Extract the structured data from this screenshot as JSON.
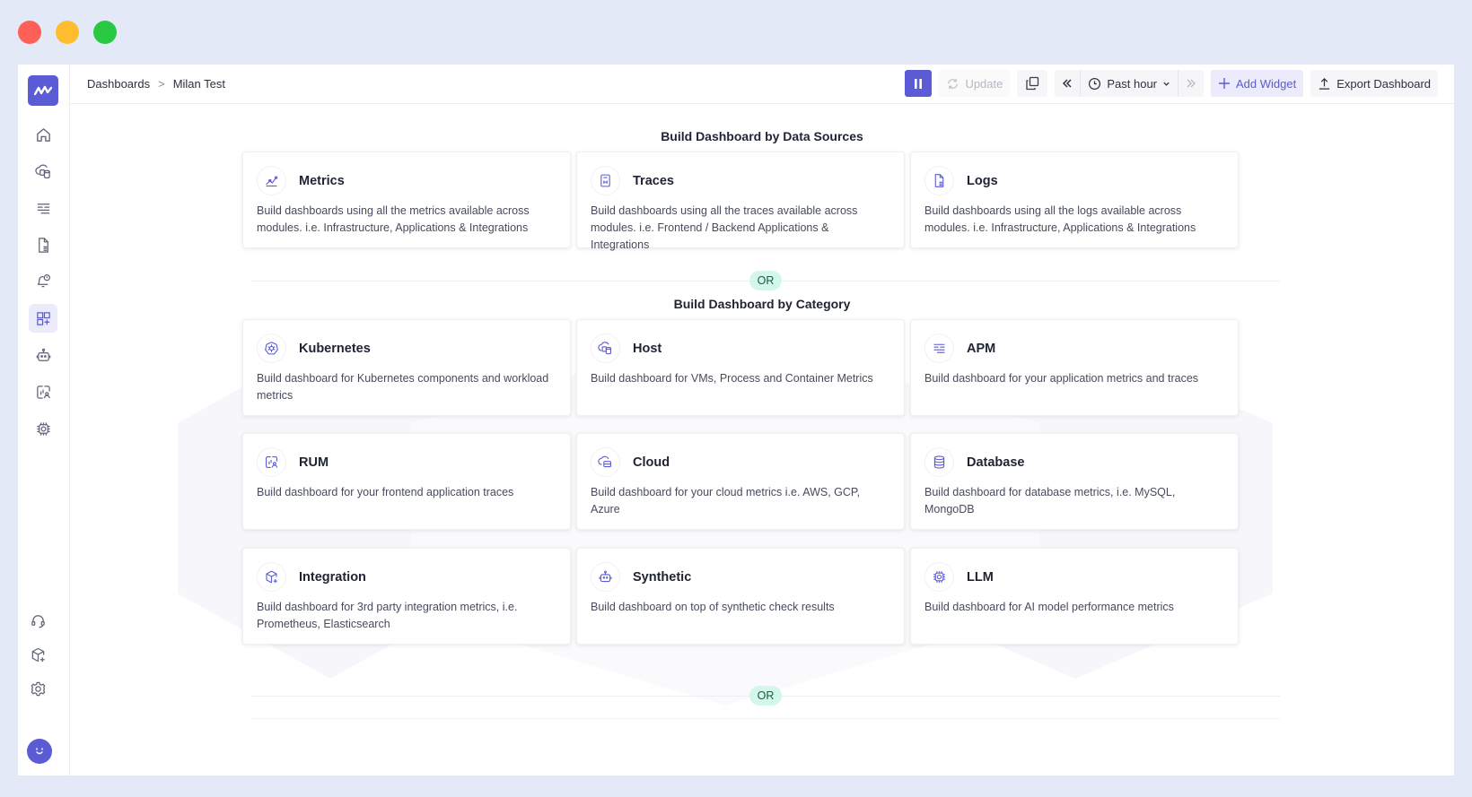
{
  "window": {
    "controls": [
      {
        "name": "close",
        "color": "#fe5f57"
      },
      {
        "name": "minimize",
        "color": "#febc2e"
      },
      {
        "name": "maximize",
        "color": "#28c840"
      }
    ]
  },
  "brand": {
    "accent": "#5b5bd6",
    "or_badge_bg": "#d3f7e8"
  },
  "breadcrumb": {
    "parent": "Dashboards",
    "separator": ">",
    "current": "Milan Test"
  },
  "toolbar": {
    "pause_icon": "pause-icon",
    "update_label": "Update",
    "copy_icon": "copy-icon",
    "prev_icon": "chevrons-left-icon",
    "time_range": "Past hour",
    "next_icon": "chevrons-right-icon",
    "add_widget_label": "Add Widget",
    "export_label": "Export Dashboard"
  },
  "sidebar": {
    "items": [
      {
        "name": "home",
        "icon": "home-icon"
      },
      {
        "name": "infrastructure",
        "icon": "cloud-database-icon"
      },
      {
        "name": "apm",
        "icon": "list-lines-icon"
      },
      {
        "name": "logs",
        "icon": "document-icon"
      },
      {
        "name": "alerts",
        "icon": "bell-alert-icon"
      },
      {
        "name": "dashboards",
        "icon": "dashboard-add-icon",
        "active": true
      },
      {
        "name": "synthetic",
        "icon": "robot-icon"
      },
      {
        "name": "rum",
        "icon": "rum-icon"
      },
      {
        "name": "llm",
        "icon": "chip-icon"
      }
    ],
    "bottom_items": [
      {
        "name": "support",
        "icon": "headset-icon"
      },
      {
        "name": "integrations",
        "icon": "box-plus-icon"
      },
      {
        "name": "settings",
        "icon": "gear-icon"
      }
    ]
  },
  "sections": {
    "data_sources_title": "Build Dashboard by Data Sources",
    "or_label": "OR",
    "category_title": "Build Dashboard by Category"
  },
  "data_sources": [
    {
      "title": "Metrics",
      "icon": "metrics-icon",
      "desc": "Build dashboards using all the metrics available across modules. i.e. Infrastructure, Applications & Integrations"
    },
    {
      "title": "Traces",
      "icon": "traces-icon",
      "desc": "Build dashboards using all the traces available across modules. i.e. Frontend / Backend Applications & Integrations"
    },
    {
      "title": "Logs",
      "icon": "logs-icon",
      "desc": "Build dashboards using all the logs available across modules. i.e. Infrastructure, Applications & Integrations"
    }
  ],
  "categories": [
    {
      "title": "Kubernetes",
      "icon": "kubernetes-icon",
      "desc": "Build dashboard for Kubernetes components and workload metrics"
    },
    {
      "title": "Host",
      "icon": "host-icon",
      "desc": "Build dashboard for VMs, Process and Container Metrics"
    },
    {
      "title": "APM",
      "icon": "apm-icon",
      "desc": "Build dashboard for your application metrics and traces"
    },
    {
      "title": "RUM",
      "icon": "rum-icon",
      "desc": "Build dashboard for your frontend application traces"
    },
    {
      "title": "Cloud",
      "icon": "cloud-icon",
      "desc": "Build dashboard for your cloud metrics i.e. AWS, GCP, Azure"
    },
    {
      "title": "Database",
      "icon": "database-icon",
      "desc": "Build dashboard for database metrics, i.e. MySQL, MongoDB"
    },
    {
      "title": "Integration",
      "icon": "integration-icon",
      "desc": "Build dashboard for 3rd party integration metrics, i.e. Prometheus, Elasticsearch"
    },
    {
      "title": "Synthetic",
      "icon": "synthetic-icon",
      "desc": "Build dashboard on top of synthetic check results"
    },
    {
      "title": "LLM",
      "icon": "llm-icon",
      "desc": "Build dashboard for AI model performance metrics"
    }
  ]
}
